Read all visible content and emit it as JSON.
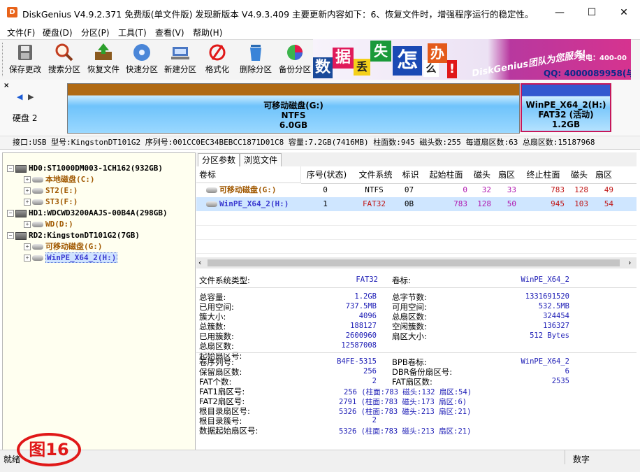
{
  "window": {
    "title": "DiskGenius V4.9.2.371 免费版(单文件版)   发现新版本 V4.9.3.409 主要更新内容如下：6、恢复文件时，增强程序运行的稳定性。",
    "minimize": "—",
    "maximize": "☐",
    "close": "✕"
  },
  "menu": [
    "文件(F)",
    "硬盘(D)",
    "分区(P)",
    "工具(T)",
    "查看(V)",
    "帮助(H)"
  ],
  "toolbar": {
    "buttons": [
      {
        "label": "保存更改",
        "icon": "save-icon"
      },
      {
        "label": "搜索分区",
        "icon": "magnifier-icon"
      },
      {
        "label": "恢复文件",
        "icon": "recover-file-icon"
      },
      {
        "label": "快速分区",
        "icon": "disk-cd-icon"
      },
      {
        "label": "新建分区",
        "icon": "new-partition-icon"
      },
      {
        "label": "格式化",
        "icon": "format-icon"
      },
      {
        "label": "删除分区",
        "icon": "trash-icon"
      },
      {
        "label": "备份分区",
        "icon": "pie-backup-icon"
      }
    ]
  },
  "ad": {
    "chars": [
      "数",
      "据",
      "丢",
      "失",
      "怎",
      "么",
      "办",
      "!"
    ],
    "slogan": "DiskGenius团队为您服务!",
    "phone": "QQ: 4000089958(与",
    "hotline": "资电：400-00"
  },
  "diskbar": {
    "disk_label": "硬盘 2",
    "partitions": [
      {
        "name": "可移动磁盘(G:)",
        "fs": "NTFS",
        "size": "6.0GB"
      },
      {
        "name": "WinPE_X64_2(H:)",
        "fs": "FAT32 (活动)",
        "size": "1.2GB"
      }
    ]
  },
  "disk_info": "接口:USB  型号:KingstonDT101G2  序列号:001CC0EC34BEBCC1871D01C8  容量:7.2GB(7416MB)  柱面数:945  磁头数:255  每道扇区数:63  总扇区数:15187968",
  "tree": [
    {
      "label": "HD0:ST1000DM003-1CH162(932GB)",
      "level": 0,
      "kind": "disk",
      "color": "#000000"
    },
    {
      "label": "本地磁盘(C:)",
      "level": 1,
      "kind": "part",
      "color": "#a05800"
    },
    {
      "label": "ST2(E:)",
      "level": 1,
      "kind": "part",
      "color": "#a05800"
    },
    {
      "label": "ST3(F:)",
      "level": 1,
      "kind": "part",
      "color": "#a05800"
    },
    {
      "label": "HD1:WDCWD3200AAJS-00B4A(298GB)",
      "level": 0,
      "kind": "disk",
      "color": "#000000"
    },
    {
      "label": "WD(D:)",
      "level": 1,
      "kind": "part",
      "color": "#a05800"
    },
    {
      "label": "RD2:KingstonDT101G2(7GB)",
      "level": 0,
      "kind": "disk",
      "color": "#000000"
    },
    {
      "label": "可移动磁盘(G:)",
      "level": 1,
      "kind": "part",
      "color": "#a05800"
    },
    {
      "label": "WinPE_X64_2(H:)",
      "level": 1,
      "kind": "part",
      "color": "#3a3ad0",
      "selected": true
    }
  ],
  "tabs": [
    "分区参数",
    "浏览文件"
  ],
  "grid": {
    "columns": [
      "卷标",
      "序号(状态)",
      "文件系统",
      "标识",
      "起始柱面",
      "磁头",
      "扇区",
      "终止柱面",
      "磁头",
      "扇区"
    ],
    "rows": [
      [
        "可移动磁盘(G:)",
        "0",
        "NTFS",
        "07",
        "0",
        "32",
        "33",
        "783",
        "128",
        "49"
      ],
      [
        "WinPE_X64_2(H:)",
        "1",
        "FAT32",
        "0B",
        "783",
        "128",
        "50",
        "945",
        "103",
        "54"
      ]
    ]
  },
  "detail": {
    "fs_type_label": "文件系统类型:",
    "fs_type_value": "FAT32",
    "vol_label": "卷标:",
    "vol_value": "WinPE_X64_2",
    "left1": [
      [
        "总容量:",
        "1.2GB"
      ],
      [
        "已用空间:",
        "737.5MB"
      ],
      [
        "簇大小:",
        "4096"
      ],
      [
        "总簇数:",
        "188127"
      ],
      [
        "已用簇数:",
        "2600960"
      ],
      [
        "总扇区数:",
        "12587008"
      ],
      [
        "起始扇区号:",
        ""
      ]
    ],
    "right1": [
      [
        "总字节数:",
        "1331691520"
      ],
      [
        "可用空间:",
        "532.5MB"
      ],
      [
        "总扇区数:",
        "324454"
      ],
      [
        "空闲簇数:",
        "136327"
      ],
      [
        "扇区大小:",
        "512 Bytes"
      ]
    ],
    "left2": [
      [
        "卷序列号:",
        "B4FE-5315"
      ],
      [
        "保留扇区数:",
        "256"
      ],
      [
        "FAT个数:",
        "2"
      ],
      [
        "FAT1扇区号:",
        "256 (柱面:783 磁头:132 扇区:54)"
      ],
      [
        "FAT2扇区号:",
        "2791 (柱面:783 磁头:173 扇区:6)"
      ],
      [
        "根目录扇区号:",
        "5326 (柱面:783 磁头:213 扇区:21)"
      ],
      [
        "根目录簇号:",
        "2"
      ],
      [
        "数据起始扇区号:",
        "5326 (柱面:783 磁头:213 扇区:21)"
      ]
    ],
    "right2": [
      [
        "BPB卷标:",
        "WinPE_X64_2"
      ],
      [
        "DBR备份扇区号:",
        "6"
      ],
      [
        "FAT扇区数:",
        "2535"
      ]
    ]
  },
  "status": {
    "left": "就绪",
    "right": "数字"
  },
  "figure_badge": "图16"
}
